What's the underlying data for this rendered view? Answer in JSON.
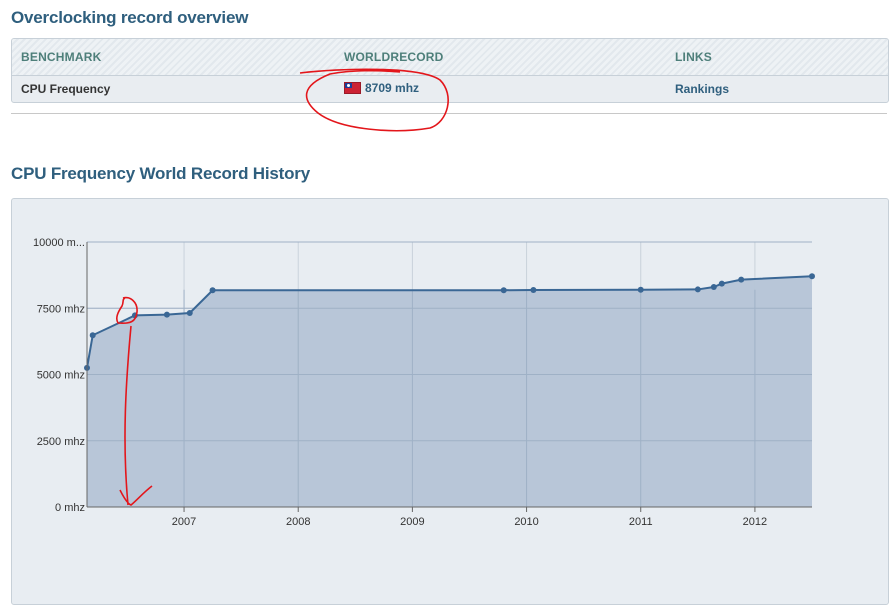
{
  "overview": {
    "title": "Overclocking record overview",
    "headers": {
      "benchmark": "BENCHMARK",
      "worldrecord": "WORLDRECORD",
      "links": "LINKS"
    },
    "row": {
      "benchmark": "CPU Frequency",
      "flag": "taiwan-flag-icon",
      "record": "8709 mhz",
      "link": "Rankings"
    }
  },
  "history": {
    "title": "CPU Frequency World Record History"
  },
  "colors": {
    "title": "#2f5f7e",
    "line": "#3a6795",
    "area": "#b5c4d6",
    "annotation": "#e3161b"
  },
  "chart_data": {
    "type": "area",
    "x_format": "decimal-year",
    "xlim": [
      2006.15,
      2012.5
    ],
    "ylim": [
      0,
      10000
    ],
    "yticks": [
      0,
      2500,
      5000,
      7500,
      10000
    ],
    "ytick_labels": [
      "0 mhz",
      "2500 mhz",
      "5000 mhz",
      "7500 mhz",
      "10000 m..."
    ],
    "xticks": [
      2007,
      2008,
      2009,
      2010,
      2011,
      2012
    ],
    "xtick_labels": [
      "2007",
      "2008",
      "2009",
      "2010",
      "2011",
      "2012"
    ],
    "grid": true,
    "series": [
      {
        "x": [
          2006.15,
          2006.2,
          2006.57,
          2006.85,
          2007.05,
          2007.25,
          2009.8,
          2010.06,
          2011.0,
          2011.5,
          2011.64,
          2011.71,
          2011.88,
          2012.5
        ],
        "y": [
          5250,
          6480,
          7230,
          7260,
          7320,
          8180,
          8180,
          8190,
          8200,
          8210,
          8300,
          8430,
          8580,
          8709
        ]
      }
    ]
  }
}
